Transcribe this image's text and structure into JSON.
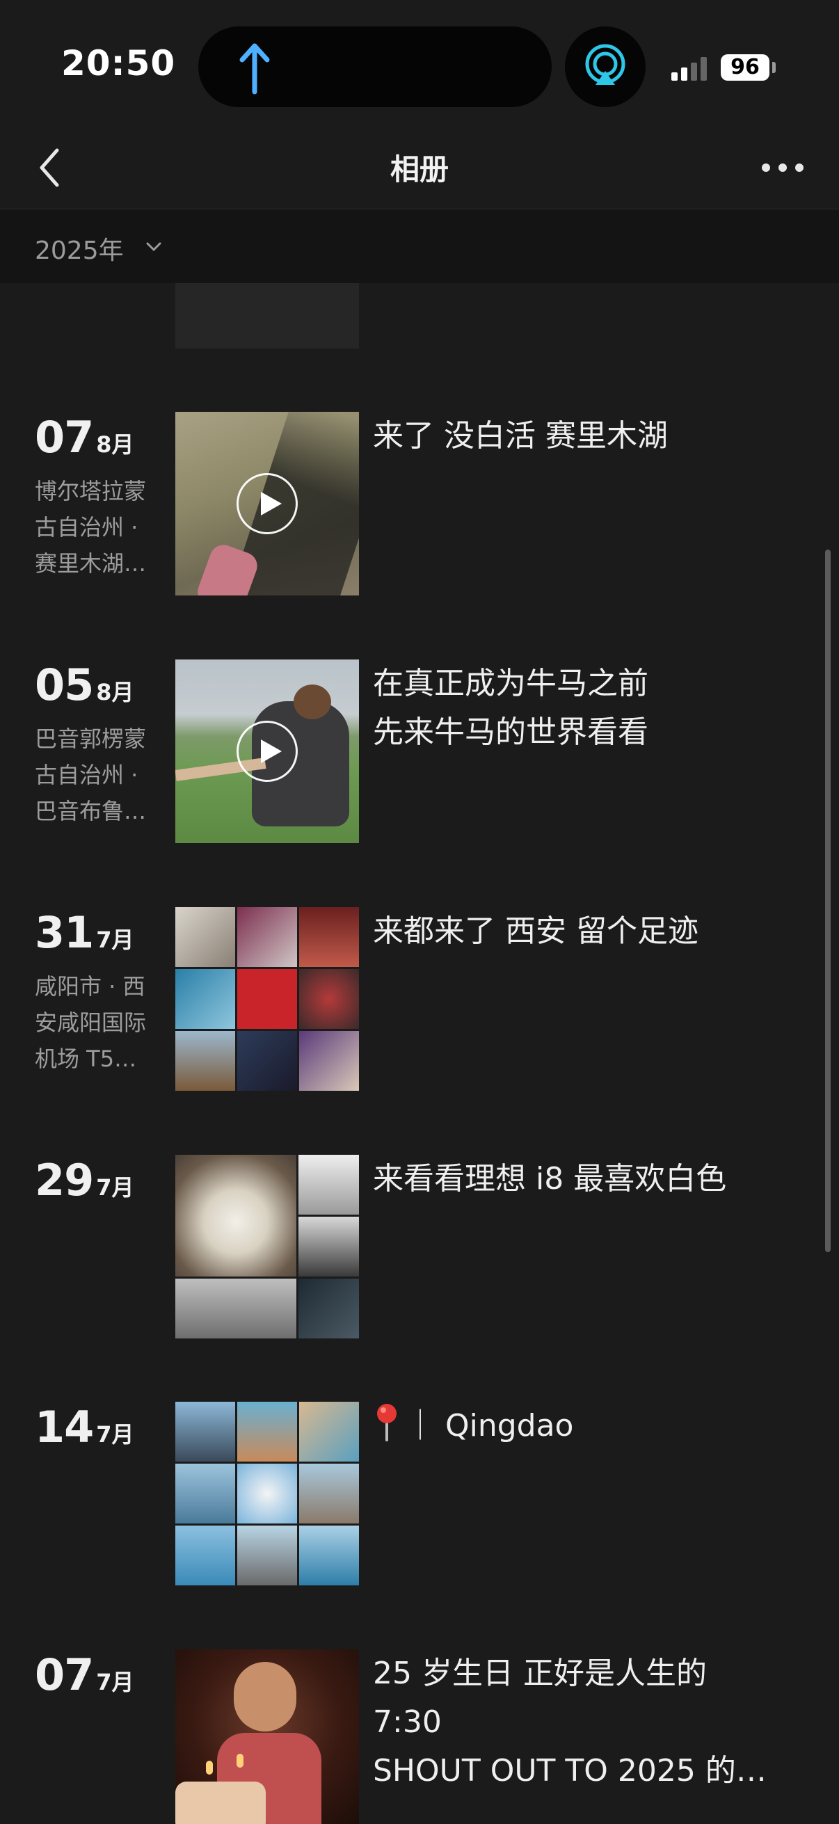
{
  "status_bar": {
    "time": "20:50",
    "battery": "96",
    "icons": [
      "upload-arrow-icon",
      "airplay-icon",
      "signal-icon",
      "battery-icon"
    ]
  },
  "nav": {
    "title": "相册",
    "back_icon": "chevron-left-icon",
    "more_icon": "more-dots-icon"
  },
  "year_filter": {
    "label": "2025年",
    "icon": "chevron-down-icon"
  },
  "colors": {
    "background": "#1b1b1b",
    "yearbar_bg": "#141414",
    "secondary_text": "#9d9d9d",
    "accent_blue": "#4fb0ff",
    "airplay_cyan": "#2fc7e8"
  },
  "entries": [
    {
      "day": "07",
      "month": "8月",
      "location_lines": [
        "博尔塔拉蒙",
        "古自治州 ·",
        "赛里木湖…"
      ],
      "caption_lines": [
        "来了 没白活 赛里木湖"
      ],
      "media": "video"
    },
    {
      "day": "05",
      "month": "8月",
      "location_lines": [
        "巴音郭楞蒙",
        "古自治州 ·",
        "巴音布鲁…"
      ],
      "caption_lines": [
        "在真正成为牛马之前",
        "先来牛马的世界看看"
      ],
      "media": "video"
    },
    {
      "day": "31",
      "month": "7月",
      "location_lines": [
        "咸阳市 · 西",
        "安咸阳国际",
        "机场 T5…"
      ],
      "caption_lines": [
        "来都来了 西安 留个足迹"
      ],
      "media": "grid9"
    },
    {
      "day": "29",
      "month": "7月",
      "location_lines": [],
      "caption_lines": [
        "来看看理想 i8 最喜欢白色"
      ],
      "media": "grid-car"
    },
    {
      "day": "14",
      "month": "7月",
      "location_lines": [],
      "caption_lines": [
        "｜ Qingdao"
      ],
      "caption_icon": "pin-icon",
      "media": "grid9"
    },
    {
      "day": "07",
      "month": "7月",
      "location_lines": [],
      "caption_lines": [
        "25 岁生日  正好是人生的",
        "7:30",
        "SHOUT OUT TO 2025 的…"
      ],
      "media": "photo"
    }
  ]
}
